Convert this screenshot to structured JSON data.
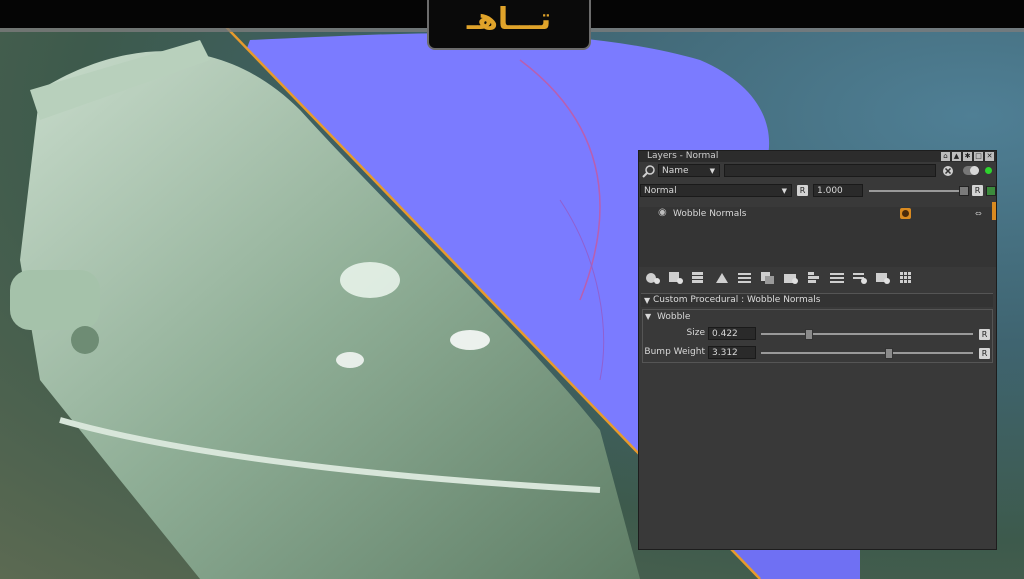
{
  "logo": {
    "text": "تـــاهـ"
  },
  "panel": {
    "title": "Layers - Normal",
    "search": {
      "filter_value": "Name",
      "text_value": ""
    },
    "blend": {
      "mode": "Normal",
      "reset": "R",
      "opacity": "1.000",
      "reset2": "R"
    },
    "layers": [
      {
        "name": "Wobble Normals"
      }
    ],
    "section_title": "Custom Procedural : Wobble Normals",
    "group_title": "Wobble",
    "params": [
      {
        "label": "Size",
        "value": "0.422",
        "reset": "R",
        "fraction": 0.22
      },
      {
        "label": "Bump Weight",
        "value": "3.312",
        "reset": "R",
        "fraction": 0.6
      }
    ]
  },
  "colors": {
    "accent": "#d98a20",
    "bg": "#393939",
    "normal_map": "#7b7bff",
    "status_green": "#2ed32e"
  }
}
